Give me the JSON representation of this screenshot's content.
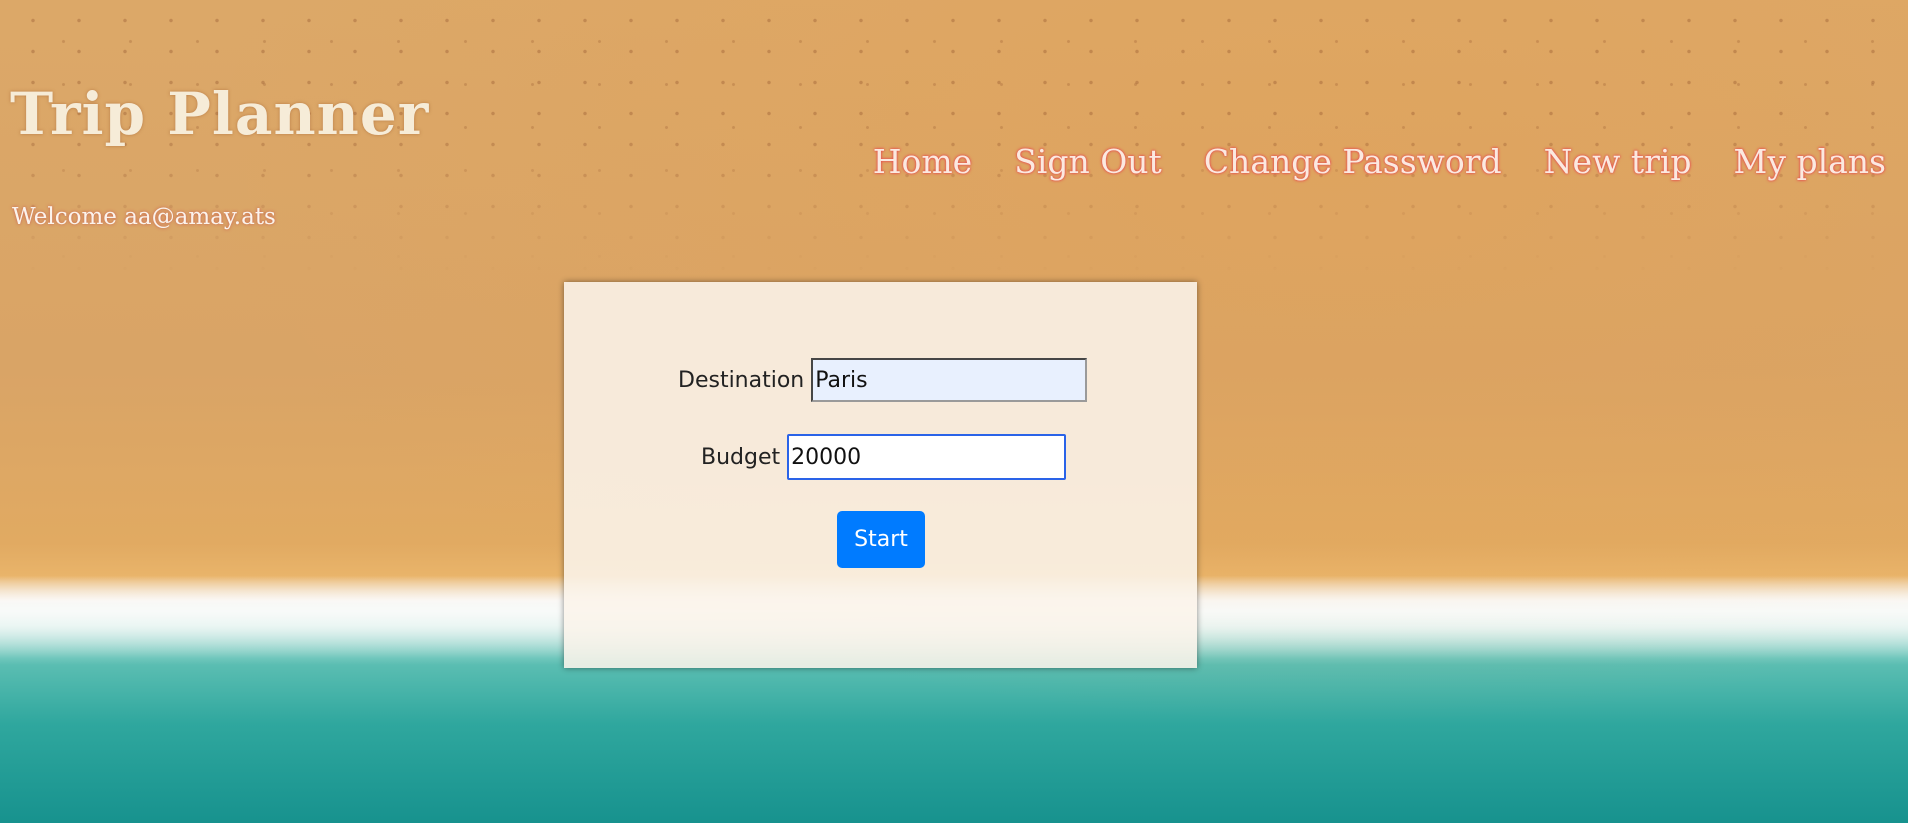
{
  "header": {
    "title": "Trip Planner",
    "welcome": "Welcome aa@amay.ats"
  },
  "nav": {
    "items": [
      {
        "label": "Home"
      },
      {
        "label": "Sign Out"
      },
      {
        "label": "Change Password"
      },
      {
        "label": "New trip"
      },
      {
        "label": "My plans"
      }
    ]
  },
  "form": {
    "destination_label": "Destination",
    "destination_value": "Paris",
    "budget_label": "Budget",
    "budget_value": "20000",
    "start_label": "Start"
  },
  "colors": {
    "button": "#007bff",
    "nav_glow": "#e65050",
    "autofill_bg": "#e8f0fe"
  }
}
